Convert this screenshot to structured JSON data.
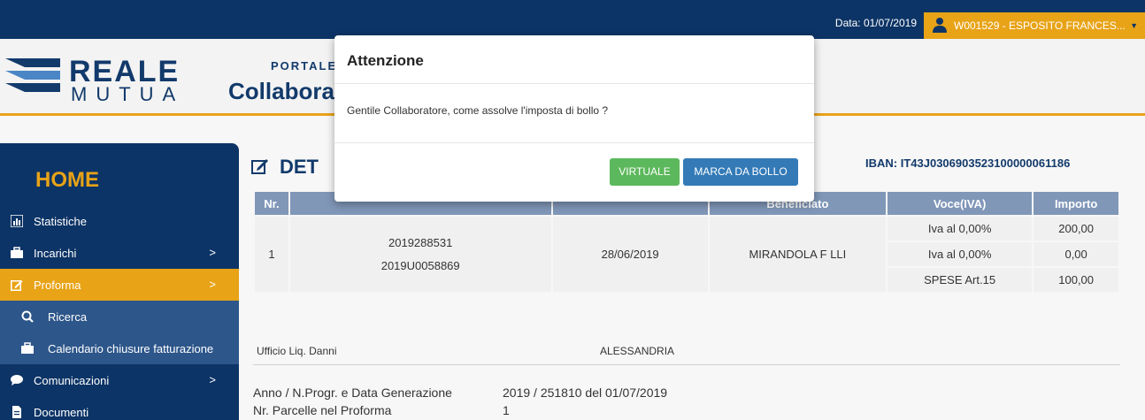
{
  "topbar": {
    "date_label": "Data: 01/07/2019",
    "user": "W001529 - ESPOSITO FRANCES..."
  },
  "header": {
    "brand_line1": "REALE",
    "brand_line2": "MUTUA",
    "portal_line1": "PORTALE",
    "portal_line2": "Collabora"
  },
  "sidebar": {
    "home": "HOME",
    "items": [
      {
        "label": "Statistiche",
        "icon": "bar-chart-icon"
      },
      {
        "label": "Incarichi",
        "icon": "briefcase-icon",
        "chevron": ">"
      },
      {
        "label": "Proforma",
        "icon": "edit-icon",
        "chevron": ">"
      },
      {
        "label": "Ricerca",
        "icon": "search-icon"
      },
      {
        "label": "Calendario chiusure fatturazione",
        "icon": "briefcase-icon"
      },
      {
        "label": "Comunicazioni",
        "icon": "chat-icon",
        "chevron": ">"
      },
      {
        "label": "Documenti",
        "icon": "document-icon"
      }
    ]
  },
  "content": {
    "title": "DET",
    "iban": "IBAN: IT43J0306903523100000061186",
    "table": {
      "headers": [
        "Nr.",
        "",
        "",
        "Beneficiato",
        "Voce(IVA)",
        "Importo"
      ],
      "row": {
        "nr": "1",
        "codes": [
          "2019288531",
          "2019U0058869"
        ],
        "date": "28/06/2019",
        "beneficiario": "MIRANDOLA F LLI",
        "voci": [
          "Iva al 0,00%",
          "Iva al 0,00%",
          "SPESE Art.15"
        ],
        "importi": [
          "200,00",
          "0,00",
          "100,00"
        ]
      }
    },
    "ufficio_label": "Ufficio Liq. Danni",
    "ufficio_value": "ALESSANDRIA",
    "anno_label": "Anno / N.Progr. e Data Generazione",
    "anno_value": "2019 / 251810 del 01/07/2019",
    "parcelle_label": "Nr. Parcelle nel Proforma",
    "parcelle_value": "1"
  },
  "modal": {
    "title": "Attenzione",
    "message": "Gentile Collaboratore, come assolve l'imposta di bollo ?",
    "btn_virtuale": "VIRTUALE",
    "btn_marca": "MARCA DA BOLLO"
  },
  "colors": {
    "navy": "#0d3466",
    "gold": "#e8a317",
    "green": "#5cb85c",
    "blue": "#337ab7"
  }
}
